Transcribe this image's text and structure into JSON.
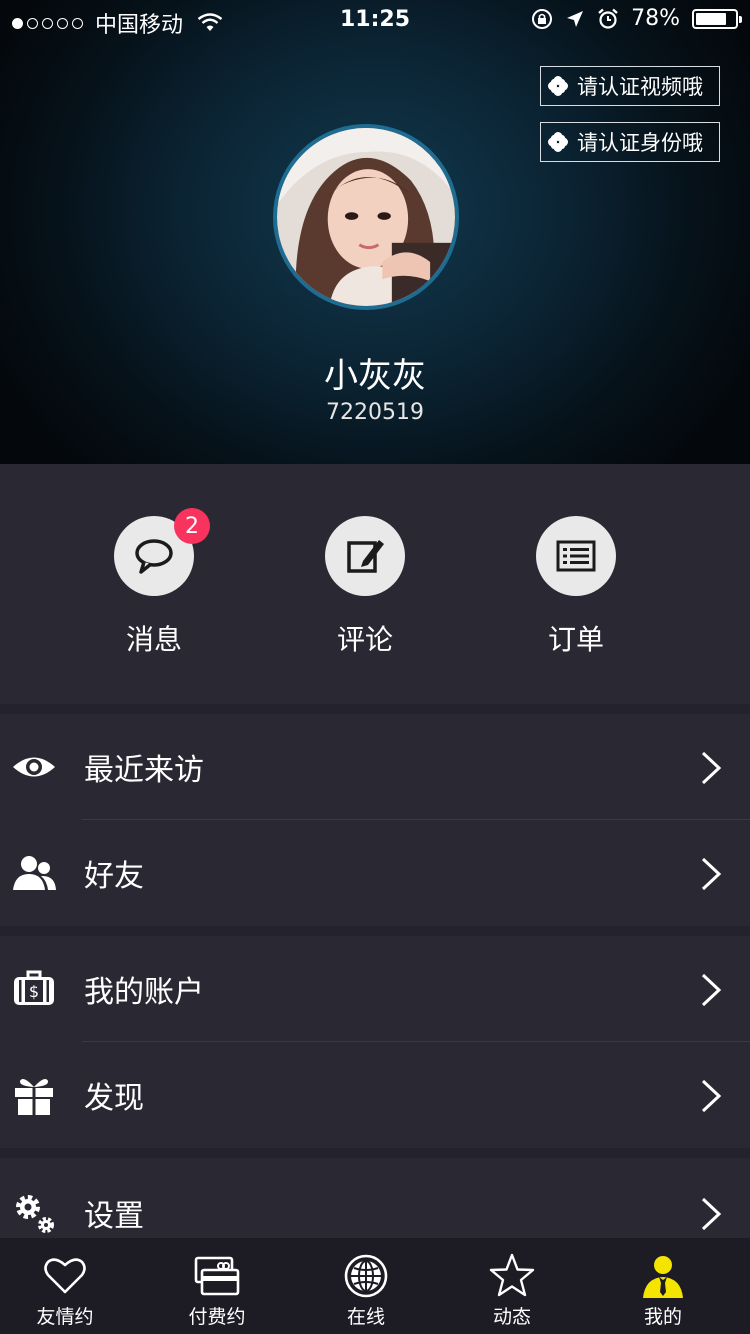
{
  "status_bar": {
    "carrier": "中国移动",
    "time": "11:25",
    "battery": "78%",
    "battery_level": 0.78,
    "signal_bars_filled": 1,
    "signal_bars_total": 5
  },
  "profile": {
    "verify_video": "请认证视频哦",
    "verify_identity": "请认证身份哦",
    "name": "小灰灰",
    "id": "7220519"
  },
  "quick_actions": [
    {
      "label": "消息",
      "icon": "chat-bubble-icon",
      "badge": "2"
    },
    {
      "label": "评论",
      "icon": "edit-pencil-icon"
    },
    {
      "label": "订单",
      "icon": "order-list-icon"
    }
  ],
  "menu": {
    "recent_visitors": "最近来访",
    "friends": "好友",
    "my_account": "我的账户",
    "discover": "发现",
    "settings": "设置"
  },
  "tabs": [
    {
      "label": "友情约",
      "icon": "heart-icon"
    },
    {
      "label": "付费约",
      "icon": "card-icon"
    },
    {
      "label": "在线",
      "icon": "globe-icon"
    },
    {
      "label": "动态",
      "icon": "star-icon"
    },
    {
      "label": "我的",
      "icon": "person-icon",
      "active": true
    }
  ],
  "colors": {
    "background": "#24232d",
    "row_background": "#2a2933",
    "badge": "#f7335e",
    "active_tab": "#f5e400",
    "avatar_ring": "#1f6c92"
  }
}
